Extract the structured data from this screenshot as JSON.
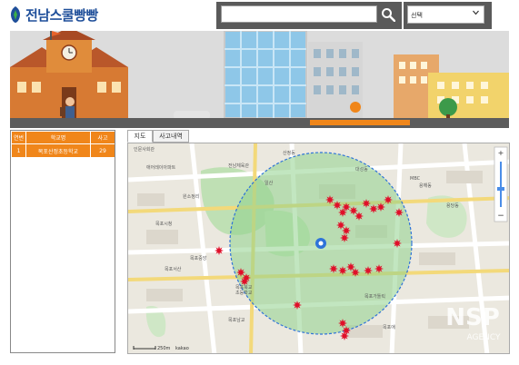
{
  "header": {
    "logo_text": "전남스쿨빵빵",
    "search": {
      "value": "",
      "placeholder": ""
    },
    "select": {
      "value": "선택"
    }
  },
  "table": {
    "columns": [
      "연번",
      "학교명",
      "사고"
    ],
    "rows": [
      {
        "num": "1",
        "school": "목포산정초등학교",
        "accidents": "29"
      }
    ]
  },
  "map_tabs": [
    {
      "label": "지도"
    },
    {
      "label": "사고내역"
    }
  ],
  "map": {
    "attribution": "kakao",
    "scale": "250m",
    "labels": [
      "인문사회관",
      "애어레이아파트",
      "전남체육관",
      "산정동",
      "대성동",
      "목포시청",
      "일산",
      "원소정리",
      "목포중앙",
      "용해동",
      "목포북교",
      "초등학교",
      "목포서산",
      "목포가톨릭",
      "목포남교",
      "목포애",
      "용당동",
      "MBC"
    ]
  },
  "colors": {
    "accent": "#f0861a",
    "logo": "#1f4f9a",
    "marker": "#e0102a",
    "circle": "#2e73d9"
  },
  "watermark": {
    "text": "NSP",
    "subtext": "AGENCY"
  }
}
